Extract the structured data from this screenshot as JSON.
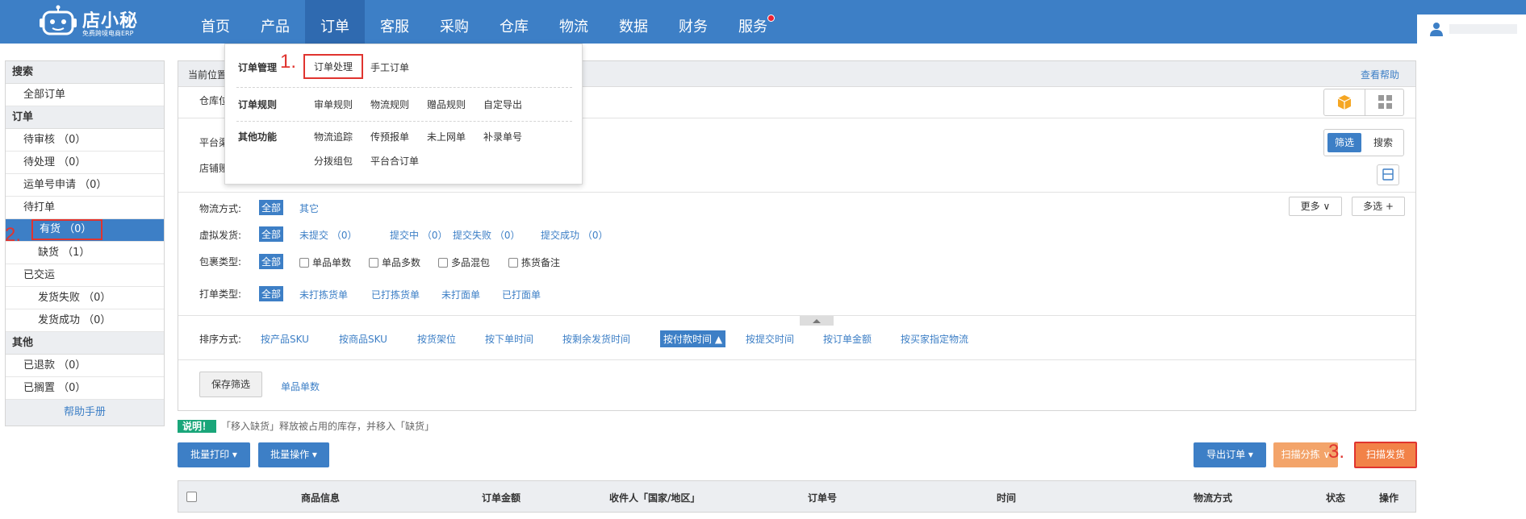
{
  "logo": {
    "name": "店小秘",
    "tagline": "免费跨境电商ERP"
  },
  "nav": [
    {
      "label": "首页"
    },
    {
      "label": "产品"
    },
    {
      "label": "订单"
    },
    {
      "label": "客服"
    },
    {
      "label": "采购"
    },
    {
      "label": "仓库"
    },
    {
      "label": "物流"
    },
    {
      "label": "数据"
    },
    {
      "label": "财务"
    },
    {
      "label": "服务"
    }
  ],
  "sidebar": {
    "search_head": "搜索",
    "all_orders": "全部订单",
    "order_head": "订单",
    "pending_review": "待审核 （0）",
    "pending_process": "待处理 （0）",
    "waybill_apply": "运单号申请 （0）",
    "pending_print": "待打单",
    "in_stock": "有货 （0）",
    "out_of_stock": "缺货 （1）",
    "shipped": "已交运",
    "ship_failed": "发货失败 （0）",
    "ship_success": "发货成功 （0）",
    "other_head": "其他",
    "refunded": "已退款 （0）",
    "on_hold": "已搁置 （0）",
    "help": "帮助手册"
  },
  "annotations": {
    "a1": "1.",
    "a2": "2.",
    "a3": "3."
  },
  "panel": {
    "crumb": "当前位置",
    "help_link": "查看帮助",
    "warehouse_label": "仓库位",
    "platform_label": "平台渠",
    "shop_label": "店铺账",
    "filter_toggle_on": "筛选",
    "filter_toggle_off": "搜索"
  },
  "filters": {
    "logistics_label": "物流方式:",
    "logistics_all": "全部",
    "logistics_other": "其它",
    "virtual_label": "虚拟发货:",
    "virtual_all": "全部",
    "virtual_opts": [
      "未提交 （0）",
      "提交中 （0）",
      "提交失败 （0）",
      "提交成功 （0）"
    ],
    "package_label": "包裹类型:",
    "package_all": "全部",
    "package_opts": [
      "单品单数",
      "单品多数",
      "多品混包",
      "拣货备注"
    ],
    "print_label": "打单类型:",
    "print_all": "全部",
    "print_opts": [
      "未打拣货单",
      "已打拣货单",
      "未打面单",
      "已打面单"
    ],
    "more": "更多",
    "multi": "多选 +"
  },
  "sort": {
    "label": "排序方式:",
    "opts": [
      "按产品SKU",
      "按商品SKU",
      "按货架位",
      "按下单时间",
      "按剩余发货时间"
    ],
    "active": "按付款时间",
    "opts2": [
      "按提交时间",
      "按订单金额",
      "按买家指定物流"
    ]
  },
  "saved": {
    "save_button": "保存筛选",
    "saved_item": "单品单数"
  },
  "dropdown": {
    "order_mgmt_label": "订单管理",
    "order_process": "订单处理",
    "manual_order": "手工订单",
    "rules_label": "订单规则",
    "rules": [
      "审单规则",
      "物流规则",
      "赠品规则",
      "自定导出"
    ],
    "other_label": "其他功能",
    "other": [
      "物流追踪",
      "传预报单",
      "未上网单",
      "补录单号",
      "分拨组包",
      "平台合订单"
    ]
  },
  "note": {
    "badge": "说明！",
    "text": "「移入缺货」释放被占用的库存，并移入「缺货」"
  },
  "actions": {
    "batch_print": "批量打印 ▾",
    "batch_ops": "批量操作 ▾",
    "export": "导出订单 ▾",
    "scan_sort": "扫描分拣",
    "scan_ship": "扫描发货"
  },
  "table": {
    "headers": [
      "商品信息",
      "订单金额",
      "收件人「国家/地区」",
      "订单号",
      "时间",
      "物流方式",
      "状态",
      "操作"
    ]
  },
  "colors": {
    "brand": "#3d7fc6",
    "annotation": "#e0342f",
    "orange": "#f28248",
    "note_badge": "#1aa67a"
  }
}
